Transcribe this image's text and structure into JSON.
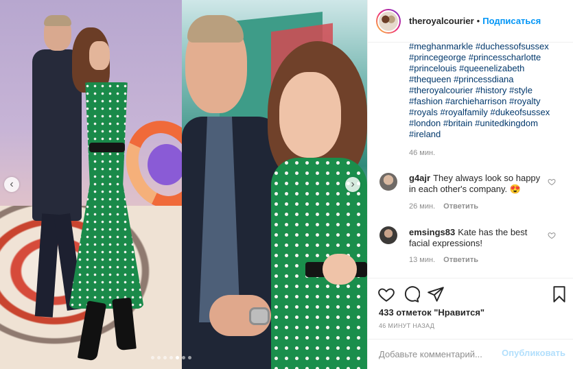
{
  "post": {
    "username": "theroyalcourier",
    "separator": "•",
    "follow_label": "Подписаться",
    "caption_lines": [
      "#meghanmarkle #duchessofsussex",
      "#princegeorge #princesscharlotte",
      "#princelouis #queenelizabeth",
      "#thequeen #princessdiana",
      "#theroyalcourier #history #style",
      "#fashion #archieharrison #royalty",
      "#royals #royalfamily #dukeofsussex",
      "#london #britain #unitedkingdom",
      "#ireland"
    ],
    "caption_time": "46 мин.",
    "comments": [
      {
        "username": "g4ajr",
        "text": "They always look so happy in each other's company. 😍",
        "time": "26 мин.",
        "reply_label": "Ответить"
      },
      {
        "username": "emsings83",
        "text": "Kate has the best facial expressions!",
        "time": "13 мин.",
        "reply_label": "Ответить"
      }
    ],
    "likes_text": "433 отметок \"Нравится\"",
    "posted_ago": "46 МИНУТ НАЗАД",
    "comment_placeholder": "Добавьте комментарий...",
    "publish_label": "Опубликовать"
  },
  "carousel": {
    "prev_icon": "‹",
    "next_icon": "›",
    "dot_count": 7,
    "active_index": 4
  },
  "colors": {
    "link": "#00376b",
    "accent": "#0095f6",
    "muted": "#8e8e8e",
    "publish_disabled": "#b2dffc"
  }
}
